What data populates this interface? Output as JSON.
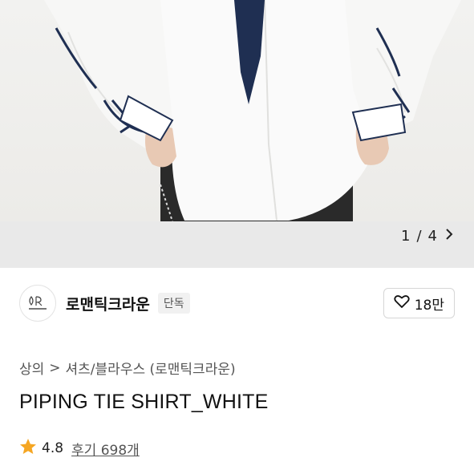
{
  "gallery": {
    "pager_current": "1",
    "pager_sep": "/",
    "pager_total": "4",
    "pager_next_icon": "chevron-right-icon"
  },
  "brand": {
    "logo_icon": "brand-logo-icon",
    "name": "로맨틱크라운",
    "badge": "단독",
    "like_icon": "heart-outline-icon",
    "like_count": "18만"
  },
  "breadcrumb": {
    "items": [
      "상의",
      "셔츠/블라우스 (로맨틱크라운)"
    ],
    "separator": ">"
  },
  "product": {
    "title": "PIPING TIE SHIRT_WHITE",
    "rating_icon": "star-icon",
    "rating": "4.8",
    "reviews": "후기 698개"
  },
  "colors": {
    "star": "#f5a623",
    "tie": "#1f2f52"
  }
}
